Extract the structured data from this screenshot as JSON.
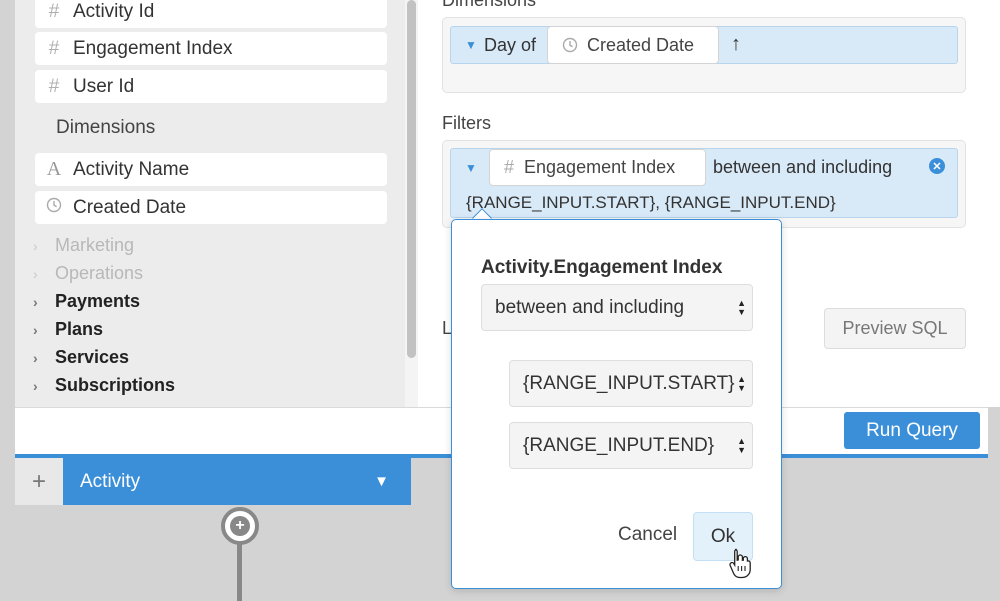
{
  "field_list": {
    "measures": [
      {
        "icon": "number-icon",
        "label": "Activity Id"
      },
      {
        "icon": "number-icon",
        "label": "Engagement Index"
      },
      {
        "icon": "number-icon",
        "label": "User Id"
      }
    ],
    "dimensions_title": "Dimensions",
    "dimensions": [
      {
        "icon": "text-type-icon",
        "label": "Activity Name"
      },
      {
        "icon": "clock-icon",
        "label": "Created Date"
      }
    ],
    "groups": [
      {
        "label": "Marketing",
        "state": "disabled"
      },
      {
        "label": "Operations",
        "state": "disabled"
      },
      {
        "label": "Payments",
        "state": "enabled"
      },
      {
        "label": "Plans",
        "state": "enabled"
      },
      {
        "label": "Services",
        "state": "enabled"
      },
      {
        "label": "Subscriptions",
        "state": "enabled"
      }
    ]
  },
  "query": {
    "dimensions_label": "Dimensions",
    "dimension_pill": {
      "prefix": "Day of",
      "field": "Created Date",
      "sort_icon": "↑"
    },
    "filters_label": "Filters",
    "filter_pill": {
      "field": "Engagement Index",
      "operator": "between and including",
      "values": "{RANGE_INPUT.START}, {RANGE_INPUT.END}"
    },
    "hidden_label_fragment": "L",
    "preview_sql": "Preview SQL",
    "run_query": "Run Query"
  },
  "node": {
    "name": "Activity"
  },
  "popup": {
    "title": "Activity.Engagement Index",
    "operator": "between and including",
    "start_value": "{RANGE_INPUT.START}",
    "end_value": "{RANGE_INPUT.END}",
    "cancel": "Cancel",
    "ok": "Ok"
  },
  "colors": {
    "accent": "#3b8fd9",
    "pill": "#d8e9f8"
  }
}
